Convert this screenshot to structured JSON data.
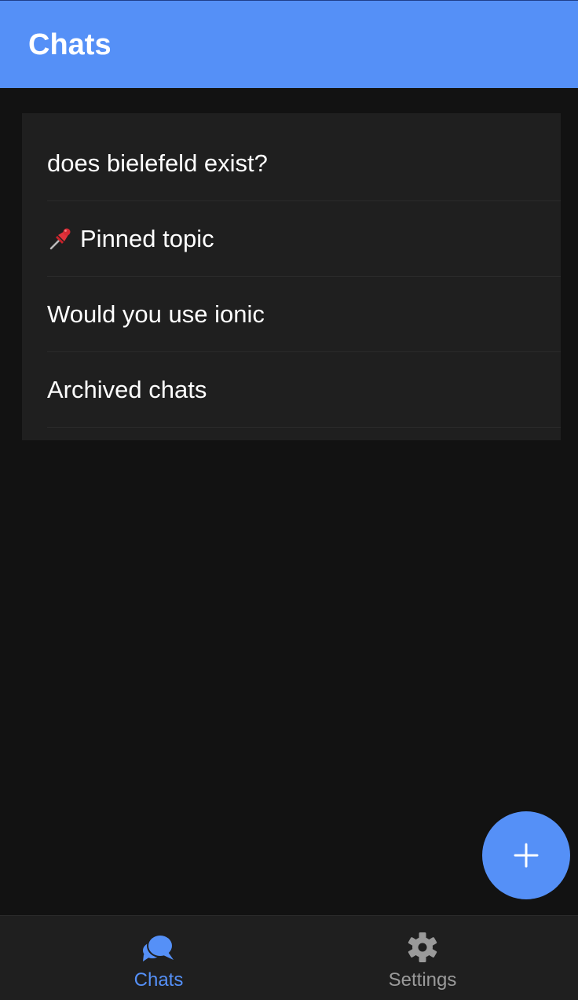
{
  "header": {
    "title": "Chats"
  },
  "chats": {
    "items": [
      {
        "label": "does bielefeld exist?",
        "pinned": false
      },
      {
        "label": "Pinned topic",
        "pinned": true
      },
      {
        "label": "Would you use ionic",
        "pinned": false
      },
      {
        "label": "Archived chats",
        "pinned": false
      }
    ]
  },
  "fab": {
    "icon": "plus-icon"
  },
  "tabs": [
    {
      "label": "Chats",
      "icon": "chat-bubbles-icon",
      "active": true
    },
    {
      "label": "Settings",
      "icon": "gear-icon",
      "active": false
    }
  ],
  "colors": {
    "accent": "#5590f7",
    "background": "#121212",
    "surface": "#1f1f1f",
    "inactive_tab": "#9a9a9a"
  }
}
